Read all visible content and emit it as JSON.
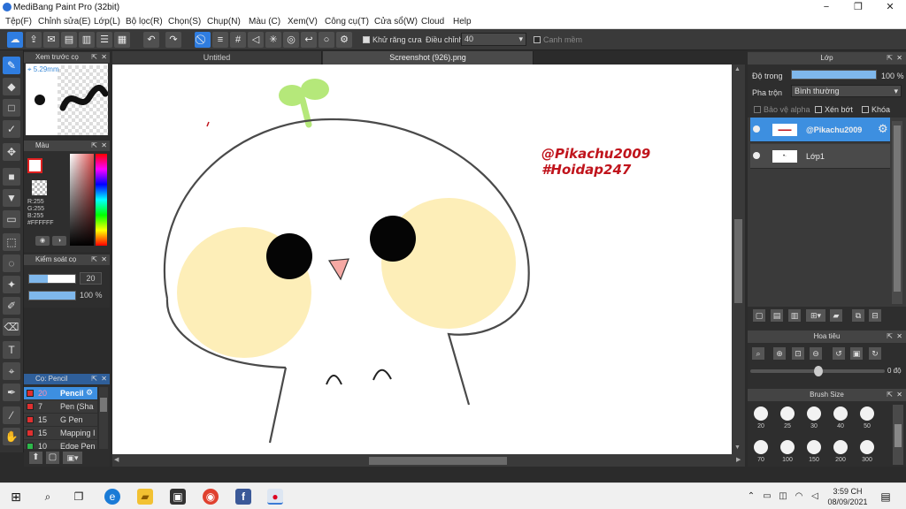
{
  "window": {
    "title": "MediBang Paint Pro (32bit)",
    "minimize": "−",
    "maximize": "❐",
    "close": "✕"
  },
  "menu": [
    "Tệp(F)",
    "Chỉnh sửa(E)",
    "Lớp(L)",
    "Bộ lọc(R)",
    "Chọn(S)",
    "Chụp(N)",
    "Màu (C)",
    "Xem(V)",
    "Công cụ(T)",
    "Cửa sổ(W)",
    "Cloud",
    "Help"
  ],
  "toolbar": {
    "antialias_label": "Khử răng cưa",
    "correction_label": "Điều chỉnh",
    "correction_value": "40",
    "snap_label": "Canh mềm"
  },
  "tabs": [
    "Untitled",
    "Screenshot (926).png"
  ],
  "brush_preview": {
    "title": "Xem trước cọ",
    "size_label": "5.29mm"
  },
  "color_panel": {
    "title": "Màu",
    "r": "R:255",
    "g": "G:255",
    "b": "B:255",
    "hex": "#FFFFFF"
  },
  "brush_control": {
    "title": "Kiểm soát cọ",
    "size": "20",
    "opacity": "100 %"
  },
  "brush_list": {
    "title": "Cọ: Pencil",
    "items": [
      {
        "size": "20",
        "name": "Pencil",
        "color": "#e03030",
        "selected": true
      },
      {
        "size": "7",
        "name": "Pen (Sha",
        "color": "#e03030",
        "selected": false
      },
      {
        "size": "15",
        "name": "G Pen",
        "color": "#e03030",
        "selected": false
      },
      {
        "size": "15",
        "name": "Mapping I",
        "color": "#e03030",
        "selected": false
      },
      {
        "size": "10",
        "name": "Edge Pen",
        "color": "#2db84a",
        "selected": false
      }
    ]
  },
  "layer_panel": {
    "title": "Lớp",
    "opacity_label": "Độ trong",
    "opacity_value": "100 %",
    "opacity_fraction": 1.0,
    "blend_label": "Pha trộn",
    "blend_value": "Bình thường",
    "protect_alpha": "Bảo vệ alpha",
    "clipping": "Xén bớt",
    "lock": "Khóa",
    "layers": [
      {
        "name": "@Pikachu2009",
        "selected": true
      },
      {
        "name": "Lớp1",
        "selected": false
      }
    ]
  },
  "navigator": {
    "title": "Hoa tiêu",
    "angle": "0 độ"
  },
  "brush_size": {
    "title": "Brush Size",
    "sizes": [
      "20",
      "25",
      "30",
      "40",
      "50",
      "70",
      "100",
      "150",
      "200",
      "300"
    ]
  },
  "canvas_text": {
    "line1": "@Pikachu2009",
    "line2": "#Hoidap247"
  },
  "taskbar": {
    "time": "3:59 CH",
    "date": "08/09/2021"
  },
  "colors": {
    "accent": "#2f7de0",
    "watermark": "#c0141c",
    "cheek": "#fdeeb8",
    "sprout": "#b5e87a"
  }
}
